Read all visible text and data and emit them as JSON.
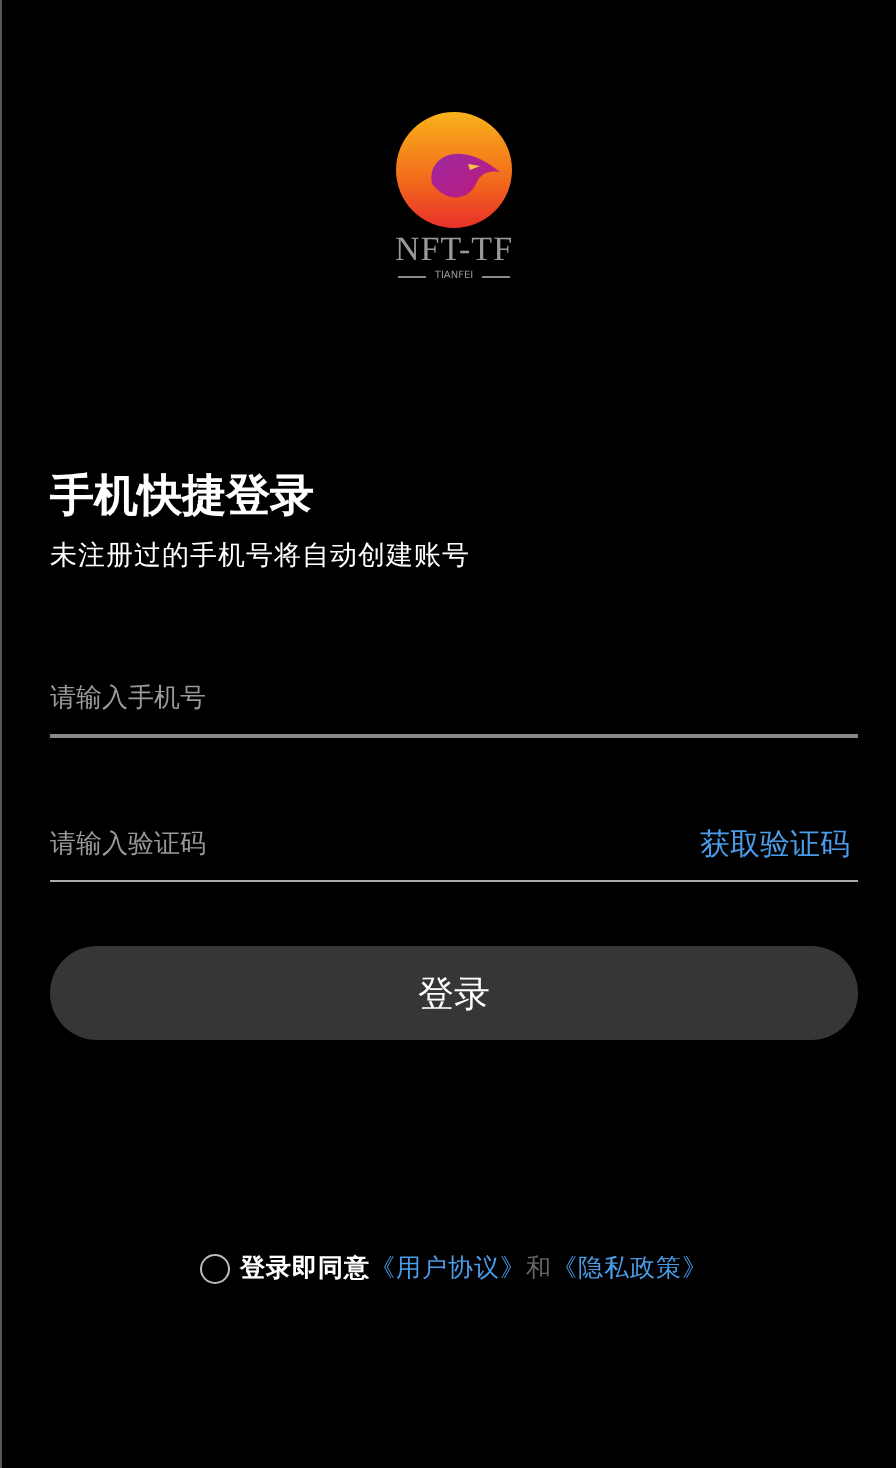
{
  "logo": {
    "name": "NFT-TF",
    "subtitle": "TIANFEI"
  },
  "title": "手机快捷登录",
  "subtitle": "未注册过的手机号将自动创建账号",
  "fields": [
    {
      "kind": "phone",
      "placeholder": "请输入手机号"
    },
    {
      "kind": "code",
      "placeholder": "请输入验证码",
      "action": "获取验证码"
    }
  ],
  "login_button": "登录",
  "agreement": {
    "checked": false,
    "prefix": "登录即同意",
    "links": [
      "《用户协议》",
      "《隐私政策》"
    ],
    "joiner": "和"
  }
}
